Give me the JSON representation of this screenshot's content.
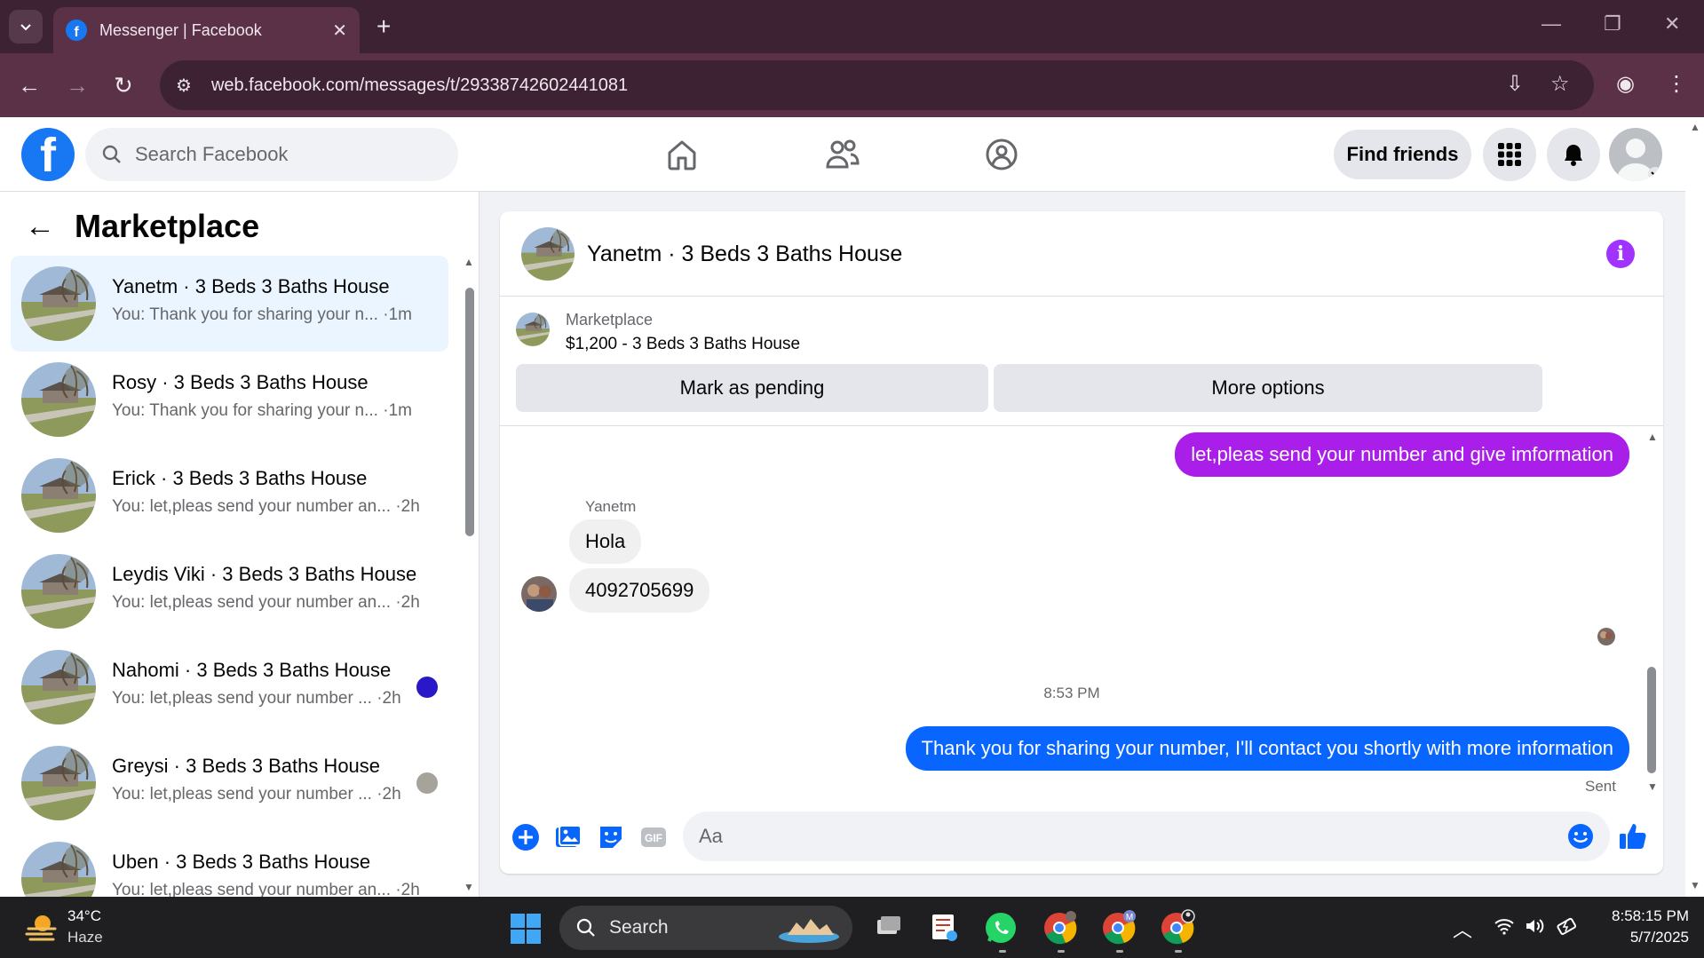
{
  "browser": {
    "tab_title": "Messenger | Facebook",
    "url": "web.facebook.com/messages/t/29338742602441081"
  },
  "header": {
    "search_placeholder": "Search Facebook",
    "find_friends_label": "Find friends"
  },
  "sidebar": {
    "title": "Marketplace",
    "conversations": [
      {
        "name": "Yanetm · 3 Beds 3 Baths House",
        "preview": "You: Thank you for sharing your n... ·1m",
        "active": true
      },
      {
        "name": "Rosy · 3 Beds 3 Baths House",
        "preview": "You: Thank you for sharing your n... ·1m",
        "active": false
      },
      {
        "name": "Erick · 3 Beds 3 Baths House",
        "preview": "You: let,pleas send your number an... ·2h",
        "active": false
      },
      {
        "name": "Leydis Viki · 3 Beds 3 Baths House",
        "preview": "You: let,pleas send your number an... ·2h",
        "active": false
      },
      {
        "name": "Nahomi · 3 Beds 3 Baths House",
        "preview": "You: let,pleas send your number ... ·2h",
        "active": false
      },
      {
        "name": "Greysi · 3 Beds 3 Baths House",
        "preview": "You: let,pleas send your number ... ·2h",
        "active": false
      },
      {
        "name": "Uben · 3 Beds 3 Baths House",
        "preview": "You: let,pleas send your number an... ·2h",
        "active": false
      }
    ]
  },
  "chat": {
    "title": "Yanetm · 3 Beds 3 Baths House",
    "listing_label": "Marketplace",
    "listing_price": "$1,200 - 3 Beds 3 Baths House",
    "mark_pending_label": "Mark as pending",
    "more_options_label": "More options",
    "messages": {
      "out_1": "let,pleas send your number and give imformation",
      "sender_name": "Yanetm",
      "in_1": "Hola",
      "in_2": "4092705699",
      "timestamp": "8:53 PM",
      "out_2": "Thank you for sharing your number, I'll contact you shortly with more information",
      "status": "Sent"
    },
    "composer_placeholder": "Aa"
  },
  "taskbar": {
    "weather_temp": "34°C",
    "weather_desc": "Haze",
    "search_label": "Search",
    "time": "8:58:15 PM",
    "date": "5/7/2025"
  },
  "colors": {
    "facebook_blue": "#1877f2",
    "outgoing_purple": "#a91ee8",
    "outgoing_blue": "#0866ff",
    "info_purple": "#a033ff"
  }
}
